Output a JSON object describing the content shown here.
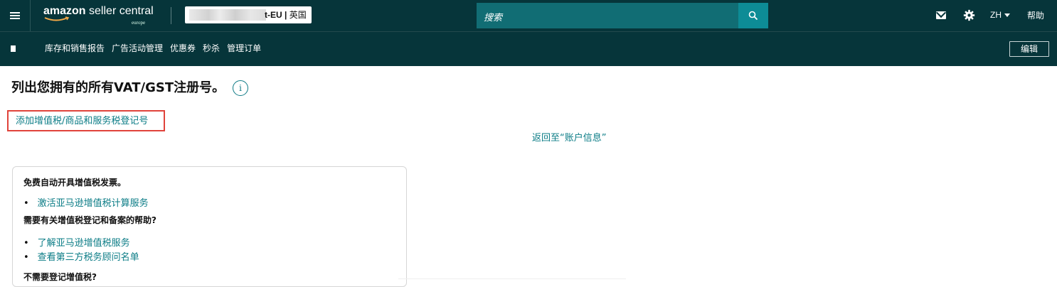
{
  "header": {
    "brand_main": "amazon",
    "brand_rest": "seller central",
    "brand_region": "europe",
    "store_suffix": "t-EU |",
    "store_country": "英国",
    "search_placeholder": "搜索",
    "language": "ZH",
    "help": "帮助"
  },
  "nav": {
    "items": [
      "库存和销售报告",
      "广告活动管理",
      "优惠券",
      "秒杀",
      "管理订单"
    ],
    "edit_label": "编辑"
  },
  "main": {
    "title": "列出您拥有的所有VAT/GST注册号。",
    "info_icon_glyph": "i",
    "add_link": "添加增值税/商品和服务税登记号",
    "back_link": "返回至“账户信息”"
  },
  "card": {
    "heading1": "免费自动开具增值税发票。",
    "link1": "激活亚马逊增值税计算服务",
    "heading2": "需要有关增值税登记和备案的帮助?",
    "link2": "了解亚马逊增值税服务",
    "link3": "查看第三方税务顾问名单",
    "heading3": "不需要登记增值税?"
  },
  "colors": {
    "header_bg": "#06353a",
    "search_bg": "#116d74",
    "link": "#0b7c86",
    "highlight_border": "#e0433b"
  }
}
